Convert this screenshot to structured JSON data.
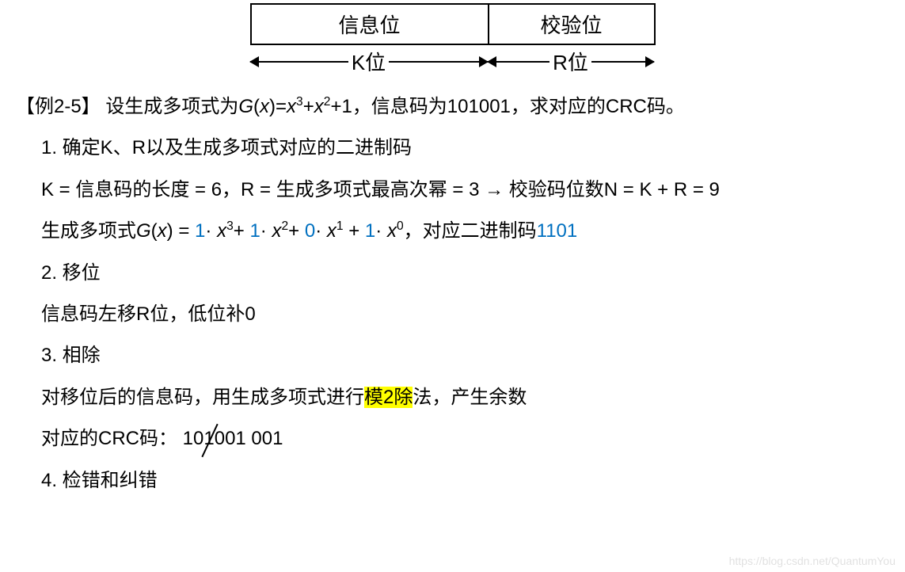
{
  "diagram": {
    "info_label": "信息位",
    "check_label": "校验位",
    "k_label": "K位",
    "r_label": "R位"
  },
  "lines": {
    "example_prefix": "【例2-5】",
    "example_body_a": " 设生成多项式为",
    "g_of_x": "G",
    "paren_x": "(x)",
    "eq": "=",
    "x": "x",
    "p3": "3",
    "plus": "+",
    "p2": "2",
    "plus1": "+1",
    "example_body_b": "，信息码为101001，求对应的CRC码。",
    "step1": "1.   确定K、R以及生成多项式对应的二进制码",
    "kline": "K = 信息码的长度 = 6，R = 生成多项式最高次幂 = 3  → 校验码位数N = K + R = 9",
    "gline_a": "生成多项式",
    "gline_eq": " = ",
    "c1": "1",
    "dot": "· ",
    "c0": "0",
    "p1": "1",
    "p0": "0",
    "gline_b": "，对应二进制码",
    "bincode": "1101",
    "step2": "2. 移位",
    "shift_desc": "信息码左移R位，低位补0",
    "step3": "3. 相除",
    "div_desc_a": "对移位后的信息码，用生成多项式进行",
    "mod2": "模2除",
    "div_desc_b": "法，产生余数",
    "crc_a": "对应的CRC码：  10",
    "crc_strike": "1",
    "crc_b": "001 001",
    "step4": "4. 检错和纠错"
  },
  "watermark": "https://blog.csdn.net/QuantumYou"
}
